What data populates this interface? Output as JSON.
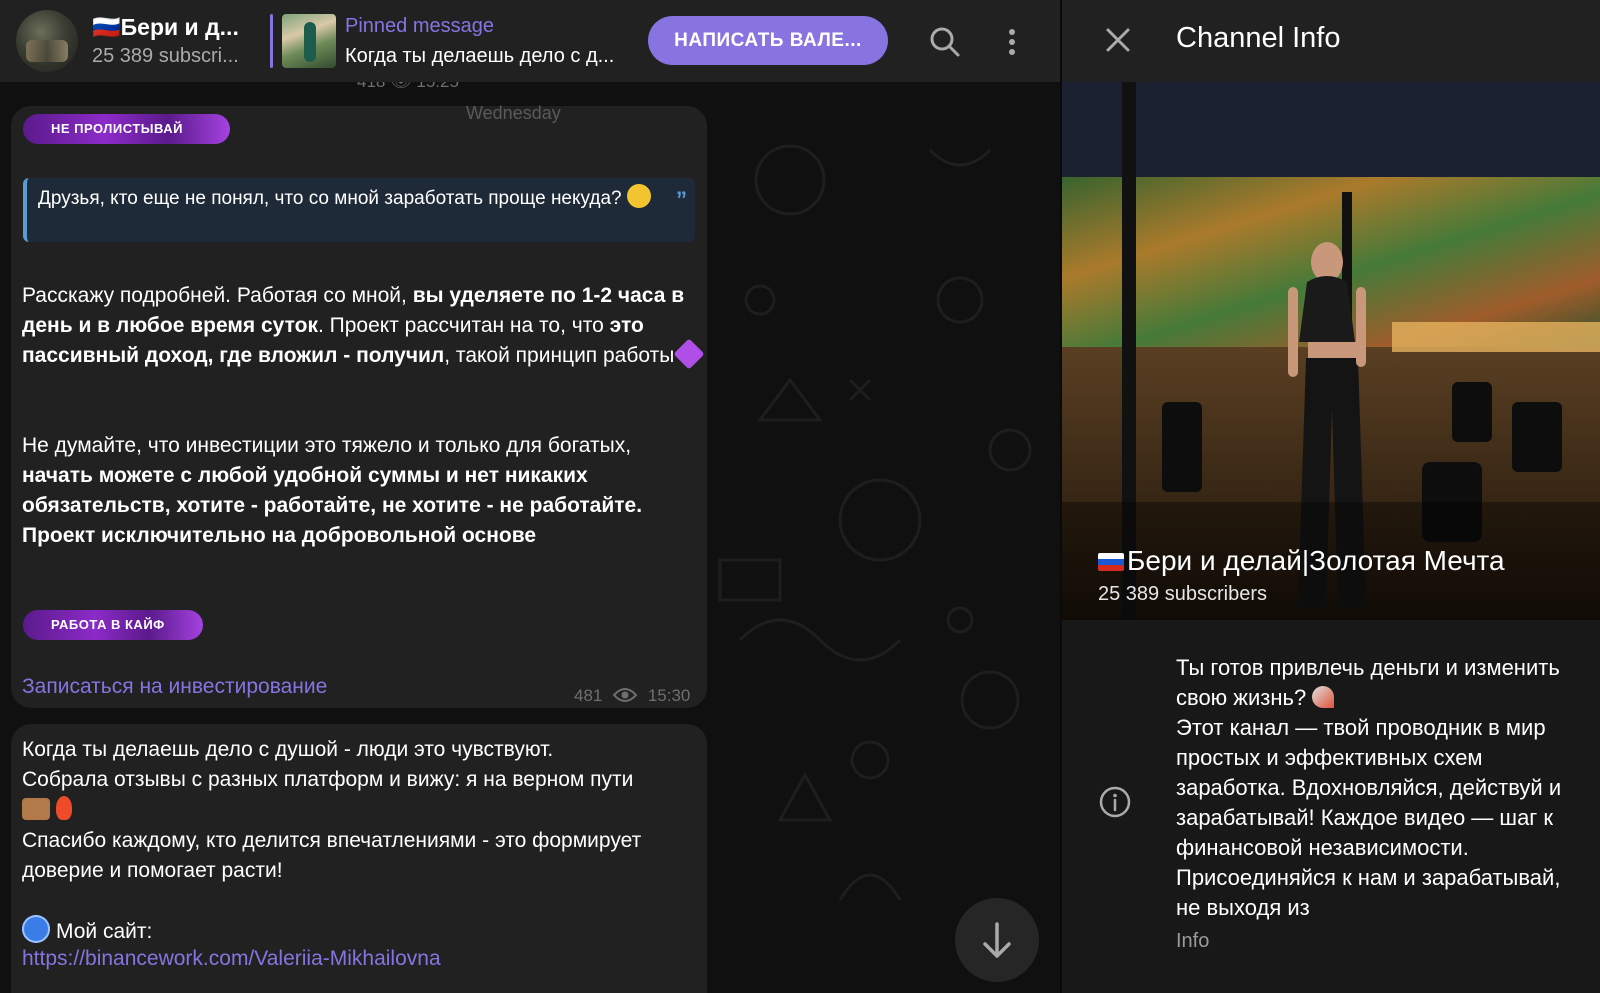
{
  "header": {
    "channel_title": "🇷🇺Бери и д...",
    "channel_subscribers": "25 389 subscri...",
    "pinned_label": "Pinned message",
    "pinned_text": "Когда ты делаешь дело с д...",
    "cta_label": "НАПИСАТЬ ВАЛЕ...",
    "search_icon": "search-icon",
    "more_icon": "more-vertical-icon"
  },
  "feed": {
    "prev_meta": "418 👁 15:25",
    "date_chip": "Wednesday",
    "scroll_icon": "arrow-down-icon"
  },
  "message1": {
    "badge_top": "НЕ ПРОЛИСТЫВАЙ",
    "quote": "Друзья, кто еще не понял, что со мной заработать проще некуда?",
    "p1_a": "Расскажу подробней. Работая со мной, ",
    "p1_b": "вы уделяете по 1-2 часа в день и в любое время суток",
    "p1_c": ". Проект рассчитан на то, что ",
    "p1_d": "это пассивный доход, где вложил - получил",
    "p1_e": ", такой принцип работы",
    "p2_a": "Не думайте, что инвестиции это тяжело и только для богатых, ",
    "p2_b": "начать можете с любой удобной суммы и нет никаких обязательств, хотите - работайте, не хотите - не работайте. Проект исключительно на добровольной основе",
    "badge_bottom": "РАБОТА В КАЙФ",
    "link": "Записаться на инвестирование",
    "views": "481",
    "time": "15:30"
  },
  "message2": {
    "line1": "Когда ты делаешь дело с душой - люди это чувствуют.",
    "line2": "Собрала отзывы с разных платформ и вижу: я на верном пути",
    "line3": "Спасибо каждому, кто делится впечатлениями - это формирует доверие и помогает расти!",
    "site_label": "Мой сайт:",
    "site_url": "https://binancework.com/Valeriia-Mikhailovna"
  },
  "panel": {
    "title": "Channel Info",
    "close_icon": "close-icon",
    "channel_name": "Бери и делай|Золотая Мечта",
    "subscribers": "25 389 subscribers",
    "about_1": "Ты готов привлечь деньги и изменить свою жизнь?",
    "about_2": "Этот канал — твой проводник в мир простых и эффективных схем заработка. Вдохновляйся, действуй и зарабатывай! Каждое видео — шаг к финансовой независимости. Присоединяйся к нам и зарабатывай, не выходя из",
    "about_caption": "Info",
    "info_icon": "info-icon"
  },
  "colors": {
    "accent": "#8774e1",
    "bubble": "#212121",
    "quote_bar": "#5b9bd5",
    "badge": "#8c2bc8"
  }
}
